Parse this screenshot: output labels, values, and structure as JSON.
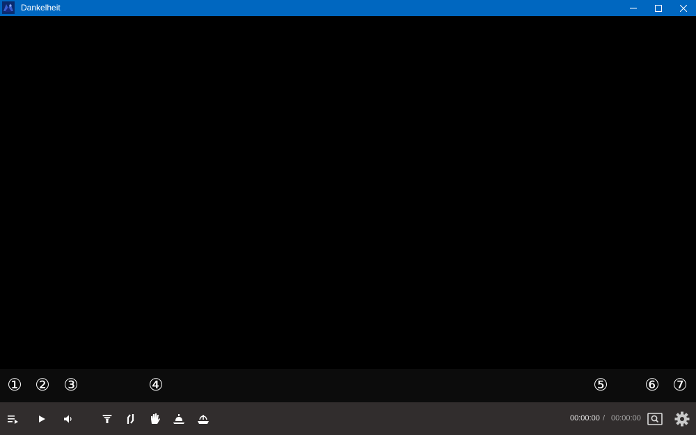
{
  "window": {
    "title": "Dankelheit",
    "controls": {
      "minimize": "minimize-icon",
      "maximize": "maximize-icon",
      "close": "close-icon"
    },
    "accent_color": "#0067c0"
  },
  "markers": [
    "①",
    "②",
    "③",
    "④",
    "⑤",
    "⑥",
    "⑦"
  ],
  "controlbar": {
    "background_color": "#312d2d",
    "buttons": [
      {
        "name": "playlist-button",
        "icon": "playlist-icon"
      },
      {
        "name": "play-button",
        "icon": "play-icon"
      },
      {
        "name": "volume-button",
        "icon": "speaker-icon"
      },
      {
        "name": "effect-1-button",
        "icon": "funnel-icon"
      },
      {
        "name": "effect-2-button",
        "icon": "split-icon"
      },
      {
        "name": "effect-3-button",
        "icon": "hand-icon"
      },
      {
        "name": "effect-4-button",
        "icon": "bell-icon"
      },
      {
        "name": "effect-5-button",
        "icon": "fountain-icon"
      },
      {
        "name": "search-button",
        "icon": "search-icon"
      },
      {
        "name": "settings-button",
        "icon": "gear-icon"
      }
    ],
    "current_time": "00:00:00",
    "separator": "/",
    "total_time": "00:00:00"
  }
}
